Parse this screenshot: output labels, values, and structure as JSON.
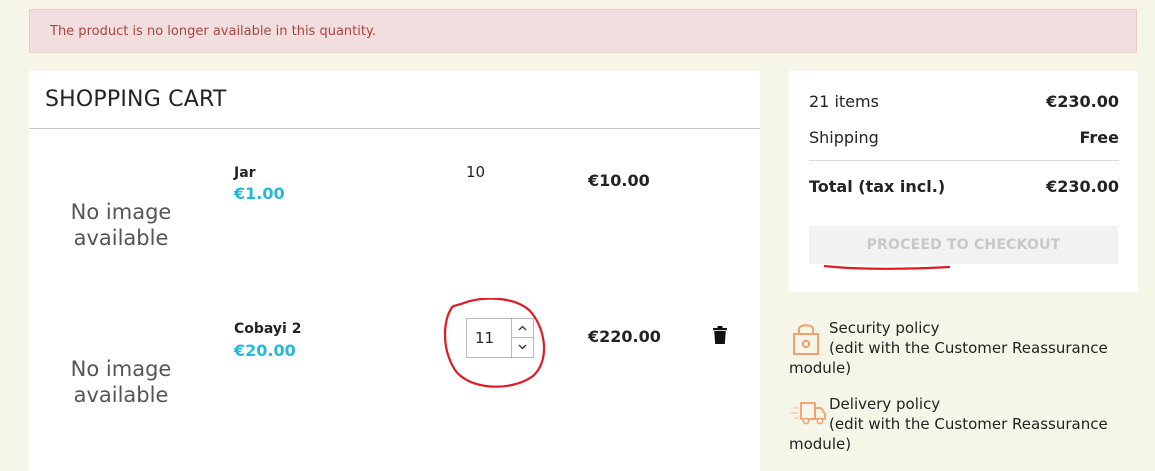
{
  "alert": {
    "message": "The product is no longer available in this quantity."
  },
  "cart": {
    "title": "SHOPPING CART",
    "items": [
      {
        "image_placeholder_line1": "No image",
        "image_placeholder_line2": "available",
        "name": "Jar",
        "unit_price": "€1.00",
        "quantity": "10",
        "total": "€10.00"
      },
      {
        "image_placeholder_line1": "No image",
        "image_placeholder_line2": "available",
        "name": "Cobayi 2",
        "unit_price": "€20.00",
        "quantity": "11",
        "total": "€220.00",
        "icons": {
          "increase": "chevron-up-icon",
          "decrease": "chevron-down-icon",
          "remove": "trash-icon"
        }
      }
    ]
  },
  "summary": {
    "items_label": "21 items",
    "items_value": "€230.00",
    "shipping_label": "Shipping",
    "shipping_value": "Free",
    "total_label": "Total (tax incl.)",
    "total_value": "€230.00",
    "checkout_label": "PROCEED TO CHECKOUT"
  },
  "reassurance": [
    {
      "title": "Security policy",
      "desc": "(edit with the Customer Reassurance",
      "desc2": "module)",
      "icon": "lock-icon"
    },
    {
      "title": "Delivery policy",
      "desc": "(edit with the Customer Reassurance",
      "desc2": "module)",
      "icon": "truck-icon"
    }
  ],
  "colors": {
    "accent": "#24b9d7",
    "alert_bg": "#f2dede",
    "alert_text": "#a94442",
    "annotation": "#e01b24"
  }
}
